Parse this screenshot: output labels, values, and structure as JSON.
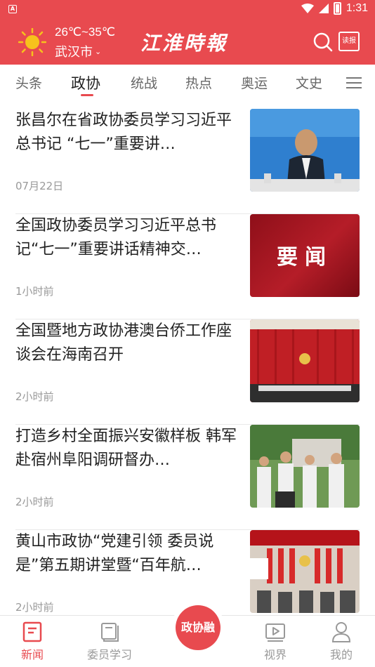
{
  "status_bar": {
    "time": "1:31"
  },
  "header": {
    "temperature": "26℃~35℃",
    "city": "武汉市",
    "logo_text": "江淮時報",
    "paper_button": "读报"
  },
  "tabs": [
    {
      "label": "头条"
    },
    {
      "label": "政协"
    },
    {
      "label": "统战"
    },
    {
      "label": "热点"
    },
    {
      "label": "奥运"
    },
    {
      "label": "文史"
    }
  ],
  "news": [
    {
      "title": "张昌尔在省政协委员学习习近平总书记 “七一”重要讲…",
      "time": "07月22日"
    },
    {
      "title": "全国政协委员学习习近平总书记“七一”重要讲话精神交…",
      "time": "1小时前",
      "thumb_text": "要闻"
    },
    {
      "title": "全国暨地方政协港澳台侨工作座谈会在海南召开",
      "time": "2小时前"
    },
    {
      "title": "打造乡村全面振兴安徽样板 韩军赴宿州阜阳调研督办…",
      "time": "2小时前"
    },
    {
      "title": "黄山市政协“党建引领 委员说是”第五期讲堂暨“百年航…",
      "time": "2小时前"
    }
  ],
  "bottom_nav": {
    "news": "新闻",
    "study": "委员学习",
    "center": "政协融",
    "vision": "视界",
    "mine": "我的"
  },
  "colors": {
    "accent": "#e84a4f"
  }
}
